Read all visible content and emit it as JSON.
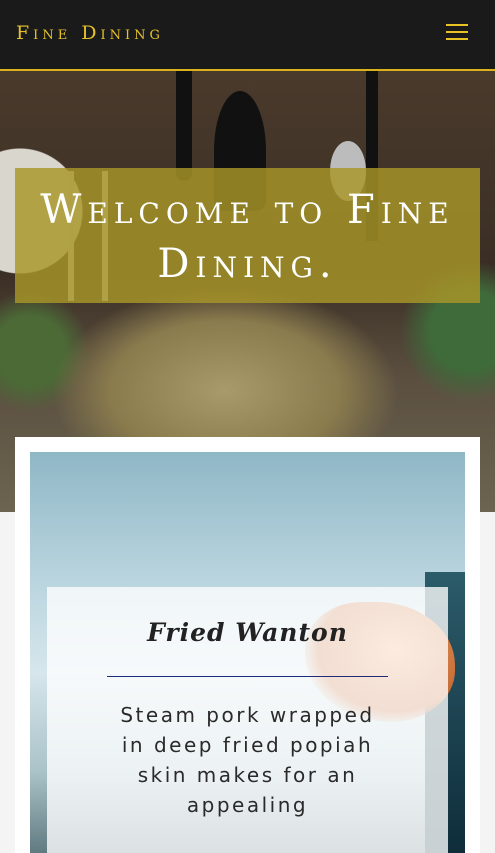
{
  "header": {
    "brand": "Fine Dining",
    "menu_icon": "hamburger-menu-icon",
    "accent_color": "#e6c22a",
    "background_color": "#1b1a1a"
  },
  "hero": {
    "title": "Welcome to Fine Dining.",
    "overlay_color": "#a89628"
  },
  "card": {
    "title": "Fried Wanton",
    "description": "Steam pork wrapped in deep fried popiah skin makes for an appealing",
    "rule_color": "#1e2b7a"
  }
}
